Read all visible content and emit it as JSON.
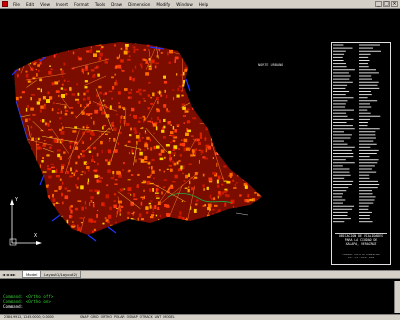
{
  "menubar": {
    "items": [
      "File",
      "Edit",
      "View",
      "Insert",
      "Format",
      "Tools",
      "Draw",
      "Dimension",
      "Modify",
      "Window",
      "Help"
    ],
    "window_buttons": [
      "_",
      "□",
      "×"
    ]
  },
  "drawing": {
    "small_label": "NORTE URBANO",
    "background": "#000000",
    "accent_colors": {
      "blocks": "#e02000",
      "highlight": "#ffcc00",
      "roads": "#2233ff",
      "boundary": "#22aa44"
    }
  },
  "legend": {
    "title_lines": [
      "UBICACION DE VIALIDADES",
      "PARA LA CIUDAD DE",
      "XALAPA, VERACRUZ"
    ],
    "footer_lines": [
      "ELABORO: DEPTO DE PLANEACION",
      "ESC: S/E     FECHA: 2008"
    ]
  },
  "ucs": {
    "y_label": "Y",
    "x_label": "X"
  },
  "tabs": {
    "nav": "◄◄◄►",
    "model": "Model",
    "layout": "Layout1/Layout2/"
  },
  "command": {
    "lines": [
      "Command: <Ortho off>",
      "Command: <Ortho on>"
    ],
    "prompt": "Command:"
  },
  "status": {
    "coords": "2384.9912, 1245.0000, 0.0000",
    "toggles": [
      "SNAP",
      "GRID",
      "ORTHO",
      "POLAR",
      "OSNAP",
      "OTRACK",
      "LWT",
      "MODEL"
    ]
  }
}
